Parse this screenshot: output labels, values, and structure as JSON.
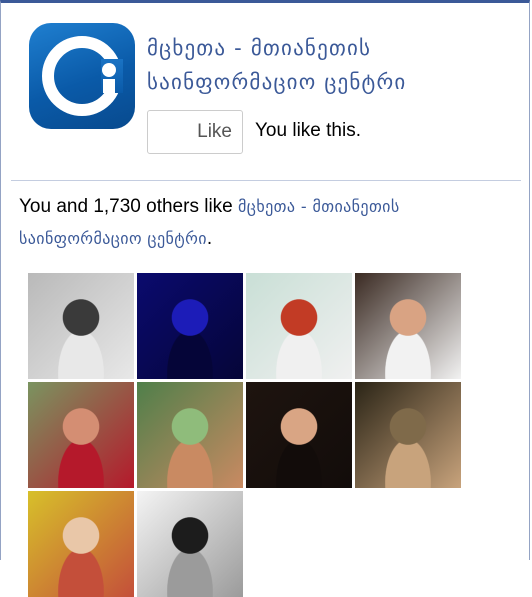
{
  "page": {
    "name": "მცხეთა - მთიანეთის საინფორმაციო ცენტრი",
    "logo_icon": "page-logo-circle-icon",
    "brand_color": "#3b5998"
  },
  "like_button": {
    "label": "Like",
    "status": "You like this."
  },
  "summary": {
    "prefix": "You and 1,730 others like ",
    "page_link": "მცხეთა - მთიანეთის საინფორმაციო ცენტრი",
    "suffix": "."
  },
  "faces": [
    {
      "name": "friend-face-1",
      "palette": [
        "#b9b9b9",
        "#3a3a3a",
        "#e8e8e8"
      ]
    },
    {
      "name": "friend-face-2",
      "palette": [
        "#0a0a6e",
        "#1c1cb8",
        "#050538"
      ]
    },
    {
      "name": "friend-face-3",
      "palette": [
        "#c9dfd6",
        "#c23b25",
        "#f0f0f0"
      ]
    },
    {
      "name": "friend-face-4",
      "palette": [
        "#3a2a22",
        "#d9a383",
        "#f2f2f2"
      ]
    },
    {
      "name": "friend-face-5",
      "palette": [
        "#7a9460",
        "#d48e73",
        "#b5192b"
      ]
    },
    {
      "name": "friend-face-6",
      "palette": [
        "#4f7f4a",
        "#8fbc7b",
        "#c98a62"
      ]
    },
    {
      "name": "friend-face-7",
      "palette": [
        "#1e140f",
        "#d9a584",
        "#120c0a"
      ]
    },
    {
      "name": "friend-face-8",
      "palette": [
        "#2a2416",
        "#7f6a4a",
        "#c8a37c"
      ]
    },
    {
      "name": "friend-face-9",
      "palette": [
        "#d7c02a",
        "#e9c7a8",
        "#c44f3a"
      ]
    },
    {
      "name": "friend-face-10",
      "palette": [
        "#f4f4f4",
        "#1c1c1c",
        "#9b9b9b"
      ]
    }
  ]
}
